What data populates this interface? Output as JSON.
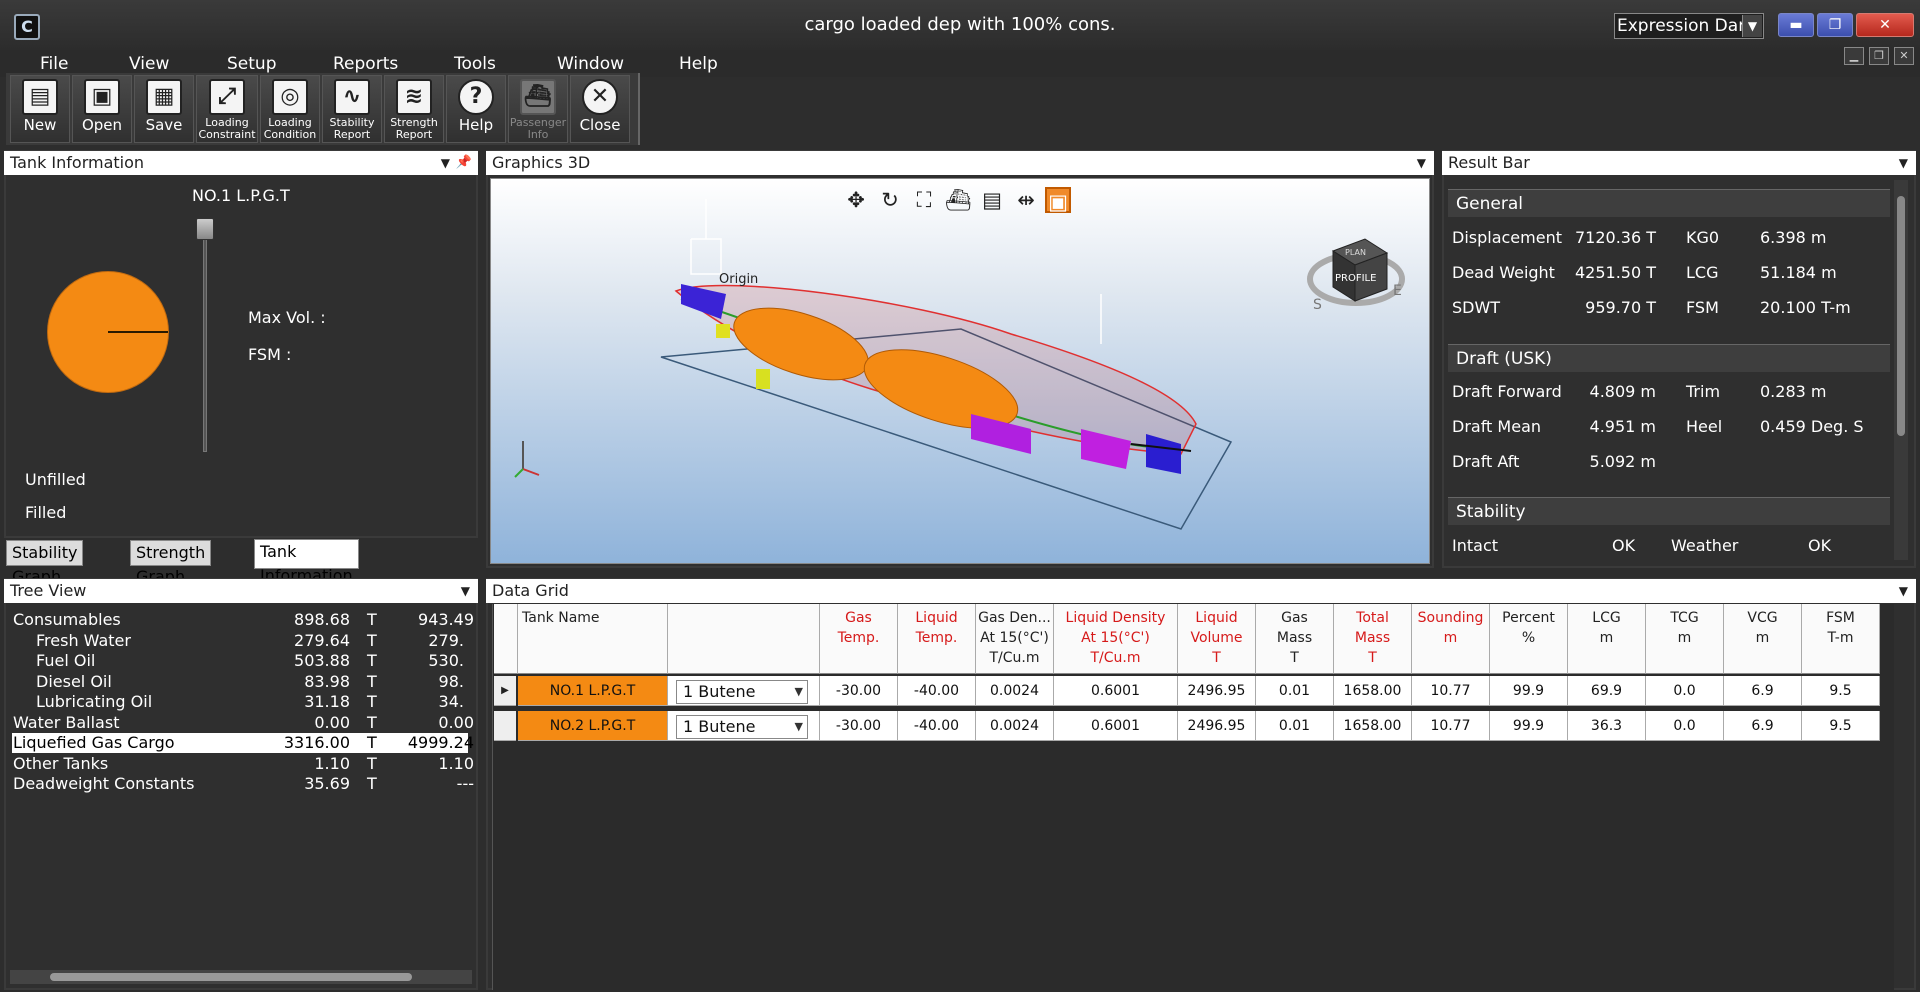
{
  "window": {
    "title": "cargo loaded dep with 100% cons.",
    "theme": "Expression Dark",
    "logo_text": "C"
  },
  "menu": [
    "File",
    "View",
    "Setup",
    "Reports",
    "Tools",
    "Window",
    "Help"
  ],
  "toolbar": [
    {
      "label": "New",
      "icon": "new-file-icon",
      "glyph": "▤"
    },
    {
      "label": "Open",
      "icon": "folder-open-icon",
      "glyph": "▣"
    },
    {
      "label": "Save",
      "icon": "save-icon",
      "glyph": "▦"
    },
    {
      "label": "Loading Constraint",
      "icon": "loading-constraint-icon",
      "glyph": "⤢"
    },
    {
      "label": "Loading Condition",
      "icon": "loading-condition-icon",
      "glyph": "◎"
    },
    {
      "label": "Stability Report",
      "icon": "stability-report-icon",
      "glyph": "∿"
    },
    {
      "label": "Strength Report",
      "icon": "strength-report-icon",
      "glyph": "≋"
    },
    {
      "label": "Help",
      "icon": "help-icon",
      "glyph": "?"
    },
    {
      "label": "Passenger Info",
      "icon": "passenger-ship-icon",
      "glyph": "⛴"
    },
    {
      "label": "Close",
      "icon": "close-circle-icon",
      "glyph": "✕"
    }
  ],
  "tank_info": {
    "header": "Tank Information",
    "tank_name": "NO.1 L.P.G.T",
    "max_vol_label": "Max Vol. :",
    "fsm_label": "FSM :",
    "unfilled": "Unfilled",
    "filled": "Filled",
    "fill_fraction": 0.999,
    "fill_color": "#f48a13"
  },
  "tabs": [
    "Stability Graph",
    "Strength Graph",
    "Tank Information"
  ],
  "tree": {
    "header": "Tree View",
    "rows": [
      {
        "name": "Consumables",
        "v1": "898.68",
        "u": "T",
        "v2": "943.49",
        "indent": 0
      },
      {
        "name": "Fresh Water",
        "v1": "279.64",
        "u": "T",
        "v2": "279.",
        "indent": 1
      },
      {
        "name": "Fuel Oil",
        "v1": "503.88",
        "u": "T",
        "v2": "530.",
        "indent": 1
      },
      {
        "name": "Diesel Oil",
        "v1": "83.98",
        "u": "T",
        "v2": "98.",
        "indent": 1
      },
      {
        "name": "Lubricating Oil",
        "v1": "31.18",
        "u": "T",
        "v2": "34.",
        "indent": 1
      },
      {
        "name": "Water Ballast",
        "v1": "0.00",
        "u": "T",
        "v2": "0.00",
        "indent": 0
      },
      {
        "name": "Liquefied Gas Cargo",
        "v1": "3316.00",
        "u": "T",
        "v2": "4999.24",
        "indent": 0,
        "selected": true
      },
      {
        "name": "Other Tanks",
        "v1": "1.10",
        "u": "T",
        "v2": "1.10",
        "indent": 0
      },
      {
        "name": "Deadweight Constants",
        "v1": "35.69",
        "u": "T",
        "v2": "---",
        "indent": 0
      }
    ]
  },
  "graphics": {
    "header": "Graphics 3D",
    "origin_label": "Origin",
    "cube_top": "PLAN",
    "cube_front": "PROFILE",
    "compass_s": "S",
    "compass_e": "E",
    "tools": [
      {
        "icon": "move-icon",
        "glyph": "✥"
      },
      {
        "icon": "rotate-icon",
        "glyph": "↻"
      },
      {
        "icon": "fit-view-icon",
        "glyph": "⛶"
      },
      {
        "icon": "ship-view-icon",
        "glyph": "⛴"
      },
      {
        "icon": "table-view-icon",
        "glyph": "▤"
      },
      {
        "icon": "section-icon",
        "glyph": "⇹"
      },
      {
        "icon": "frame-icon",
        "glyph": "▣"
      }
    ]
  },
  "result_bar": {
    "header": "Result Bar",
    "general": {
      "title": "General",
      "rows": [
        [
          "Displacement",
          "7120.36 T",
          "KG0",
          "6.398 m"
        ],
        [
          "Dead Weight",
          "4251.50 T",
          "LCG",
          "51.184 m"
        ],
        [
          "SDWT",
          "959.70 T",
          "FSM",
          "20.100 T-m"
        ]
      ]
    },
    "draft": {
      "title": "Draft (USK)",
      "rows": [
        [
          "Draft Forward",
          "4.809 m",
          "Trim",
          "0.283 m"
        ],
        [
          "Draft Mean",
          "4.951 m",
          "Heel",
          "0.459 Deg. S"
        ],
        [
          "Draft Aft",
          "5.092 m",
          "",
          ""
        ]
      ]
    },
    "stability": {
      "title": "Stability",
      "rows": [
        [
          "Intact",
          "OK",
          "Weather",
          "OK"
        ]
      ]
    }
  },
  "data_grid": {
    "header": "Data Grid",
    "columns": [
      {
        "l1": "Tank Name",
        "l2": "",
        "l3": "",
        "red": false
      },
      {
        "l1": "",
        "l2": "",
        "l3": "",
        "red": false
      },
      {
        "l1": "Gas",
        "l2": "Temp.",
        "l3": "",
        "red": true
      },
      {
        "l1": "Liquid",
        "l2": "Temp.",
        "l3": "",
        "red": true
      },
      {
        "l1": "Gas Den...",
        "l2": "At 15(°C')",
        "l3": "T/Cu.m",
        "red": false
      },
      {
        "l1": "Liquid Density",
        "l2": "At 15(°C')",
        "l3": "T/Cu.m",
        "red": true
      },
      {
        "l1": "Liquid",
        "l2": "Volume",
        "l3": "T",
        "red": true
      },
      {
        "l1": "Gas",
        "l2": "Mass",
        "l3": "T",
        "red": false
      },
      {
        "l1": "Total",
        "l2": "Mass",
        "l3": "T",
        "red": true
      },
      {
        "l1": "Sounding",
        "l2": "",
        "l3": "m",
        "red": true
      },
      {
        "l1": "Percent",
        "l2": "",
        "l3": "%",
        "red": false
      },
      {
        "l1": "LCG",
        "l2": "",
        "l3": "m",
        "red": false
      },
      {
        "l1": "TCG",
        "l2": "",
        "l3": "m",
        "red": false
      },
      {
        "l1": "VCG",
        "l2": "",
        "l3": "m",
        "red": false
      },
      {
        "l1": "FSM",
        "l2": "",
        "l3": "T-m",
        "red": false
      }
    ],
    "rows": [
      [
        "NO.1 L.P.G.T",
        "1 Butene",
        "-30.00",
        "-40.00",
        "0.0024",
        "0.6001",
        "2496.95",
        "0.01",
        "1658.00",
        "10.77",
        "99.9",
        "69.9",
        "0.0",
        "6.9",
        "9.5"
      ],
      [
        "NO.2 L.P.G.T",
        "1 Butene",
        "-30.00",
        "-40.00",
        "0.0024",
        "0.6001",
        "2496.95",
        "0.01",
        "1658.00",
        "10.77",
        "99.9",
        "36.3",
        "0.0",
        "6.9",
        "9.5"
      ]
    ]
  }
}
